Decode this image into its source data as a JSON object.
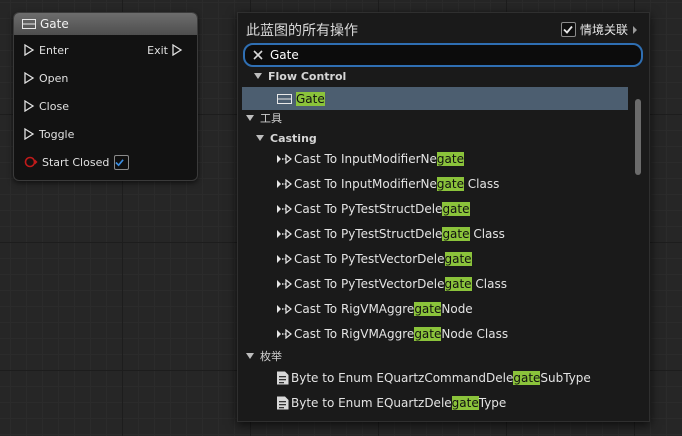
{
  "node": {
    "title": "Gate",
    "pins": [
      {
        "id": "enter",
        "label": "Enter"
      },
      {
        "id": "open",
        "label": "Open"
      },
      {
        "id": "close",
        "label": "Close"
      },
      {
        "id": "toggle",
        "label": "Toggle"
      },
      {
        "id": "start_closed",
        "label": "Start Closed",
        "checked": true
      }
    ],
    "exit_label": "Exit"
  },
  "menu": {
    "title": "此蓝图的所有操作",
    "context_label": "情境关联",
    "context_checked": true,
    "search_value": "Gate"
  },
  "rows": [
    {
      "kind": "category",
      "label": "Flow Control"
    },
    {
      "kind": "item",
      "icon": "gate-node-icon",
      "pre": "",
      "hl": "Gate",
      "post": "",
      "selected": true
    },
    {
      "kind": "section",
      "label": "工具"
    },
    {
      "kind": "category",
      "label": "Casting"
    },
    {
      "kind": "item",
      "icon": "cast-icon",
      "pre": "Cast To InputModifierNe",
      "hl": "gate",
      "post": ""
    },
    {
      "kind": "item",
      "icon": "cast-icon",
      "pre": "Cast To InputModifierNe",
      "hl": "gate",
      "post": " Class"
    },
    {
      "kind": "item",
      "icon": "cast-icon",
      "pre": "Cast To PyTestStructDele",
      "hl": "gate",
      "post": ""
    },
    {
      "kind": "item",
      "icon": "cast-icon",
      "pre": "Cast To PyTestStructDele",
      "hl": "gate",
      "post": " Class"
    },
    {
      "kind": "item",
      "icon": "cast-icon",
      "pre": "Cast To PyTestVectorDele",
      "hl": "gate",
      "post": ""
    },
    {
      "kind": "item",
      "icon": "cast-icon",
      "pre": "Cast To PyTestVectorDele",
      "hl": "gate",
      "post": " Class"
    },
    {
      "kind": "item",
      "icon": "cast-icon",
      "pre": "Cast To RigVMAggre",
      "hl": "gate",
      "post": "Node"
    },
    {
      "kind": "item",
      "icon": "cast-icon",
      "pre": "Cast To RigVMAggre",
      "hl": "gate",
      "post": "Node Class"
    },
    {
      "kind": "section",
      "label": "枚举"
    },
    {
      "kind": "item",
      "icon": "enum-icon",
      "pre": "Byte to Enum EQuartzCommandDele",
      "hl": "gate",
      "post": "SubType"
    },
    {
      "kind": "item",
      "icon": "enum-icon",
      "pre": "Byte to Enum EQuartzDele",
      "hl": "gate",
      "post": "Type"
    }
  ],
  "colors": {
    "highlight": "#8bc33b",
    "selection": "#4c5e70",
    "search_border": "#2f6fb3"
  }
}
